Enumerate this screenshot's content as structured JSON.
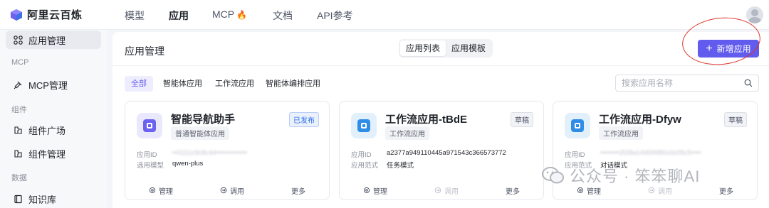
{
  "brand": {
    "name": "阿里云百炼"
  },
  "nav": {
    "items": [
      "模型",
      "应用",
      "MCP",
      "文档",
      "API参考"
    ],
    "active": "应用"
  },
  "sidebar": {
    "items": [
      {
        "label": "应用管理",
        "icon": "app-grid-icon",
        "active": true
      },
      {
        "label": "MCP管理",
        "icon": "mcp-icon"
      },
      {
        "label": "组件广场",
        "icon": "component-icon"
      },
      {
        "label": "组件管理",
        "icon": "component-icon"
      },
      {
        "label": "知识库",
        "icon": "book-icon"
      }
    ],
    "groups": [
      "MCP",
      "组件",
      "数据"
    ]
  },
  "main": {
    "title": "应用管理",
    "segments": [
      "应用列表",
      "应用模板"
    ],
    "active_segment": "应用列表",
    "add_button": "新增应用",
    "filters": [
      "全部",
      "智能体应用",
      "工作流应用",
      "智能体编排应用"
    ],
    "active_filter": "全部",
    "search": {
      "placeholder": "搜索应用名称",
      "value": ""
    }
  },
  "cards": [
    {
      "title": "智能导航助手",
      "tag": "普通智能体应用",
      "status": "已发布",
      "rows": [
        {
          "label": "应用ID",
          "value": "••0111c9c8c44•••••••••••••",
          "blurred": true
        },
        {
          "label": "选用模型",
          "value": "qwen-plus",
          "blurred": false
        }
      ],
      "actions": [
        "管理",
        "调用",
        "更多"
      ]
    },
    {
      "title": "工作流应用-tBdE",
      "tag": "工作流应用",
      "status": "草稿",
      "rows": [
        {
          "label": "应用ID",
          "value": "a2377a949110445a971543c366573772",
          "blurred": false
        },
        {
          "label": "应用范式",
          "value": "任务模式",
          "blurred": false
        }
      ],
      "actions": [
        "管理",
        "调用",
        "更多"
      ]
    },
    {
      "title": "工作流应用-Dfyw",
      "tag": "工作流应用",
      "status": "草稿",
      "rows": [
        {
          "label": "应用ID",
          "value": "••••••••2f28a14459980c0c05c5••••",
          "blurred": true
        },
        {
          "label": "应用范式",
          "value": "对话模式",
          "blurred": false
        }
      ],
      "actions": [
        "管理",
        "调用",
        "更多"
      ]
    }
  ],
  "watermark": "公众号 · 笨笨聊AI",
  "colors": {
    "accent": "#615ced",
    "annotation": "#e0352b"
  }
}
